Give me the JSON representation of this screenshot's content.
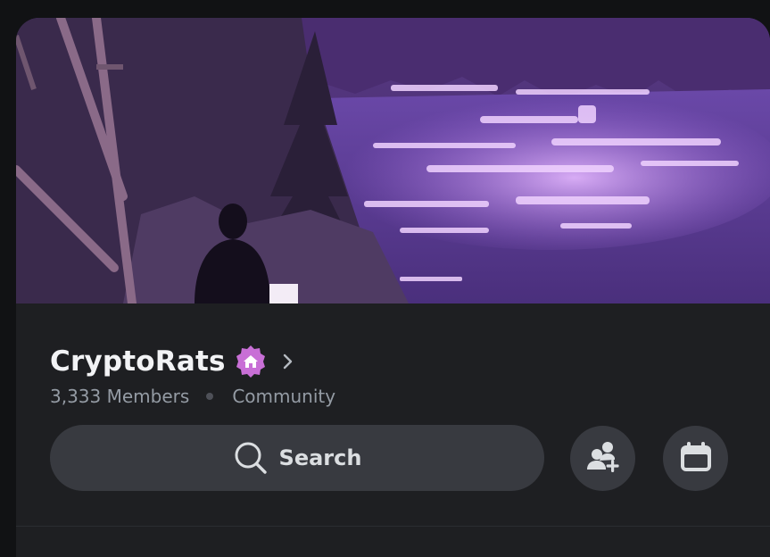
{
  "server": {
    "name": "CryptoRats",
    "members": "3,333 Members",
    "type": "Community",
    "badge_icon": "community-home-badge-icon",
    "chevron_icon": "chevron-right-icon"
  },
  "search": {
    "label": "Search",
    "icon": "search-icon"
  },
  "actions": {
    "invite_icon": "add-member-icon",
    "events_icon": "calendar-icon"
  },
  "colors": {
    "background": "#111214",
    "panel": "#1e1f22",
    "control": "#383a40",
    "title": "#f2f3f5",
    "muted": "#949ba4",
    "badge_pink": "#c86fd6",
    "banner_purple": "#7a4bb5"
  }
}
